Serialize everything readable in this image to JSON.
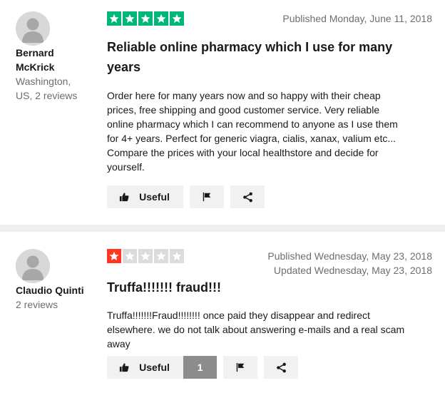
{
  "colors": {
    "star_green": "#00b67a",
    "star_red": "#ff3722",
    "star_empty": "#dcdcdc",
    "button_bg": "#f1f1f1",
    "count_bg": "#8c8c8c",
    "meta_text": "#6e6e6e"
  },
  "reviews": [
    {
      "reviewer": {
        "name_line1": "Bernard",
        "name_line2": "McKrick",
        "meta_line1": "Washington,",
        "meta_line2": "US, 2 reviews"
      },
      "rating": 5,
      "published": "Published Monday, June 11, 2018",
      "title_line1": "Reliable online pharmacy which I use for many",
      "title_line2": "years",
      "body_lines": [
        "Order here for many years now and so happy with their cheap",
        "prices, free shipping and good customer service. Very reliable",
        "online pharmacy which I can recommend to anyone as I use them",
        "for 4+ years. Perfect for generic viagra, cialis, xanax, valium etc...",
        "Compare the prices with your local healthstore and decide for",
        "yourself."
      ],
      "useful_label": "Useful"
    },
    {
      "reviewer": {
        "name_line1": "Claudio Quinti",
        "meta_line1": "2 reviews"
      },
      "rating": 1,
      "published": "Published Wednesday, May 23, 2018",
      "updated": "Updated Wednesday, May 23, 2018",
      "title": "Truffa!!!!!!! fraud!!!",
      "body_lines": [
        "Truffa!!!!!!!Fraud!!!!!!!! once paid they disappear and redirect",
        "elsewhere. we do not talk about answering e-mails and a real scam",
        "away"
      ],
      "useful_label": "Useful",
      "useful_count": "1"
    }
  ],
  "icons": {
    "thumbs_up": "thumbs-up-icon",
    "flag": "flag-icon",
    "share": "share-icon",
    "star": "star-icon",
    "avatar": "user-avatar-icon"
  }
}
